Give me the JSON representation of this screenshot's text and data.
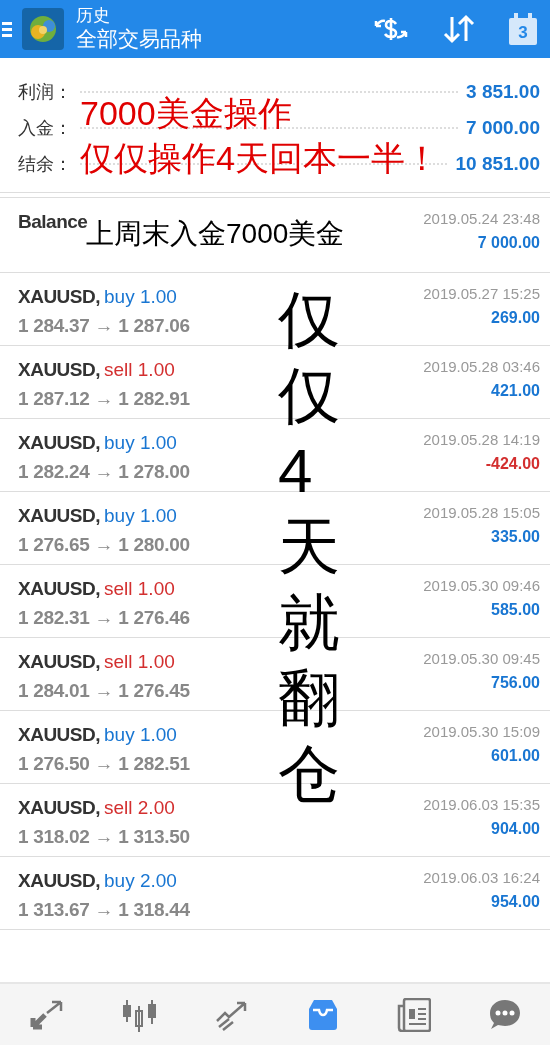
{
  "header": {
    "title": "历史",
    "subtitle": "全部交易品种",
    "calendar_day": "3"
  },
  "summary": [
    {
      "label": "利润：",
      "value": "3 851.00"
    },
    {
      "label": "入金：",
      "value": "7 000.00"
    },
    {
      "label": "结余：",
      "value": "10 851.00"
    }
  ],
  "balance": {
    "label": "Balance",
    "date": "2019.05.24 23:48",
    "amount": "7 000.00"
  },
  "trades": [
    {
      "symbol": "XAUUSD,",
      "kind": "buy",
      "order": "buy 1.00",
      "prices": "1 284.37 → 1 287.06",
      "date": "2019.05.27 15:25",
      "profit": "269.00",
      "loss": false
    },
    {
      "symbol": "XAUUSD,",
      "kind": "sell",
      "order": "sell 1.00",
      "prices": "1 287.12 → 1 282.91",
      "date": "2019.05.28 03:46",
      "profit": "421.00",
      "loss": false
    },
    {
      "symbol": "XAUUSD,",
      "kind": "buy",
      "order": "buy 1.00",
      "prices": "1 282.24 → 1 278.00",
      "date": "2019.05.28 14:19",
      "profit": "-424.00",
      "loss": true
    },
    {
      "symbol": "XAUUSD,",
      "kind": "buy",
      "order": "buy 1.00",
      "prices": "1 276.65 → 1 280.00",
      "date": "2019.05.28 15:05",
      "profit": "335.00",
      "loss": false
    },
    {
      "symbol": "XAUUSD,",
      "kind": "sell",
      "order": "sell 1.00",
      "prices": "1 282.31 → 1 276.46",
      "date": "2019.05.30 09:46",
      "profit": "585.00",
      "loss": false
    },
    {
      "symbol": "XAUUSD,",
      "kind": "sell",
      "order": "sell 1.00",
      "prices": "1 284.01 → 1 276.45",
      "date": "2019.05.30 09:45",
      "profit": "756.00",
      "loss": false
    },
    {
      "symbol": "XAUUSD,",
      "kind": "buy",
      "order": "buy 1.00",
      "prices": "1 276.50 → 1 282.51",
      "date": "2019.05.30 15:09",
      "profit": "601.00",
      "loss": false
    },
    {
      "symbol": "XAUUSD,",
      "kind": "sell",
      "order": "sell 2.00",
      "prices": "1 318.02 → 1 313.50",
      "date": "2019.06.03 15:35",
      "profit": "904.00",
      "loss": false
    },
    {
      "symbol": "XAUUSD,",
      "kind": "buy",
      "order": "buy 2.00",
      "prices": "1 313.67 → 1 318.44",
      "date": "2019.06.03 16:24",
      "profit": "954.00",
      "loss": false
    }
  ],
  "annotations": {
    "summary_note": [
      "7000美金操作",
      "仅仅操作4天回本一半！"
    ],
    "balance_note": "上周末入金7000美金",
    "vertical_note": "仅仅4天就翻仓"
  },
  "bottom_nav": [
    {
      "kind": "trade",
      "selected": false
    },
    {
      "kind": "chart",
      "selected": false
    },
    {
      "kind": "trend",
      "selected": false
    },
    {
      "kind": "history",
      "selected": true
    },
    {
      "kind": "news",
      "selected": false
    },
    {
      "kind": "chat",
      "selected": false
    }
  ]
}
